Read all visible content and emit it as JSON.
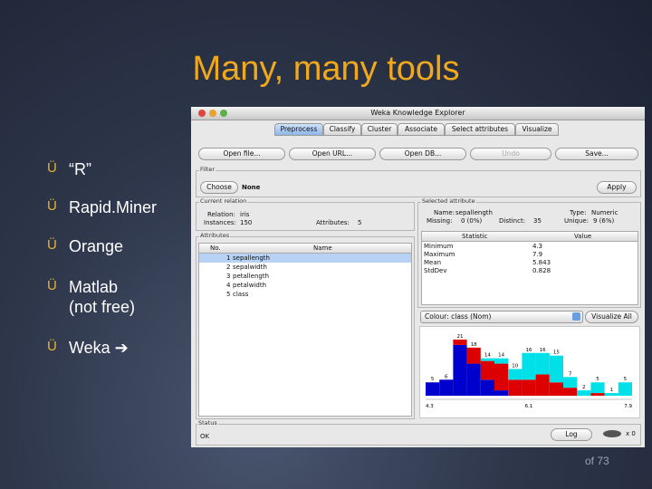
{
  "slide": {
    "title": "Many, many tools",
    "page_number": "of 73",
    "bullets": [
      {
        "mark": "Ü",
        "lines": [
          "“R”"
        ]
      },
      {
        "mark": "Ü",
        "lines": [
          "Rapid.Miner"
        ]
      },
      {
        "mark": "Ü",
        "lines": [
          "Orange"
        ]
      },
      {
        "mark": "Ü",
        "lines": [
          "Matlab",
          "(not free)"
        ]
      },
      {
        "mark": "Ü",
        "lines": [
          "Weka ➔"
        ]
      }
    ]
  },
  "weka": {
    "window_title": "Weka Knowledge Explorer",
    "tabs": [
      "Preprocess",
      "Classify",
      "Cluster",
      "Associate",
      "Select attributes",
      "Visualize"
    ],
    "active_tab": "Preprocess",
    "toolbar": {
      "open_file": "Open file...",
      "open_url": "Open URL...",
      "open_db": "Open DB...",
      "undo": "Undo",
      "save": "Save..."
    },
    "filter": {
      "label": "Filter",
      "choose": "Choose",
      "value": "None",
      "apply": "Apply"
    },
    "current_relation": {
      "label": "Current relation",
      "relation_label": "Relation:",
      "relation": "iris",
      "instances_label": "Instances:",
      "instances": "150",
      "attributes_label": "Attributes:",
      "attributes": "5"
    },
    "attributes": {
      "label": "Attributes",
      "columns": [
        "No.",
        "Name"
      ],
      "rows": [
        {
          "no": "1",
          "name": "sepallength"
        },
        {
          "no": "2",
          "name": "sepalwidth"
        },
        {
          "no": "3",
          "name": "petallength"
        },
        {
          "no": "4",
          "name": "petalwidth"
        },
        {
          "no": "5",
          "name": "class"
        }
      ],
      "selected_index": 0
    },
    "selected_attribute": {
      "label": "Selected attribute",
      "name_label": "Name:",
      "name": "sepallength",
      "type_label": "Type:",
      "type": "Numeric",
      "missing_label": "Missing:",
      "missing": "0 (0%)",
      "distinct_label": "Distinct:",
      "distinct": "35",
      "unique_label": "Unique:",
      "unique": "9 (6%)",
      "columns": [
        "Statistic",
        "Value"
      ],
      "stats": [
        {
          "statistic": "Minimum",
          "value": "4.3"
        },
        {
          "statistic": "Maximum",
          "value": "7.9"
        },
        {
          "statistic": "Mean",
          "value": "5.843"
        },
        {
          "statistic": "StdDev",
          "value": "0.828"
        }
      ]
    },
    "class_select": "Colour: class (Nom)",
    "visualize_all": "Visualize All",
    "histogram": {
      "colors": {
        "setosa": "#0000cc",
        "versicolor": "#dd0000",
        "virginica": "#00e0e8"
      },
      "bins": [
        {
          "total": 5,
          "setosa": 5,
          "versicolor": 0,
          "virginica": 0
        },
        {
          "total": 6,
          "setosa": 6,
          "versicolor": 0,
          "virginica": 0
        },
        {
          "total": 21,
          "setosa": 19,
          "versicolor": 2,
          "virginica": 0
        },
        {
          "total": 18,
          "setosa": 12,
          "versicolor": 6,
          "virginica": 0
        },
        {
          "total": 14,
          "setosa": 6,
          "versicolor": 7,
          "virginica": 1
        },
        {
          "total": 14,
          "setosa": 2,
          "versicolor": 10,
          "virginica": 2
        },
        {
          "total": 10,
          "setosa": 0,
          "versicolor": 6,
          "virginica": 4
        },
        {
          "total": 16,
          "setosa": 0,
          "versicolor": 6,
          "virginica": 10
        },
        {
          "total": 16,
          "setosa": 0,
          "versicolor": 8,
          "virginica": 8
        },
        {
          "total": 15,
          "setosa": 0,
          "versicolor": 5,
          "virginica": 10
        },
        {
          "total": 7,
          "setosa": 0,
          "versicolor": 3,
          "virginica": 4
        },
        {
          "total": 2,
          "setosa": 0,
          "versicolor": 0,
          "virginica": 2
        },
        {
          "total": 5,
          "setosa": 0,
          "versicolor": 1,
          "virginica": 4
        },
        {
          "total": 1,
          "setosa": 0,
          "versicolor": 0,
          "virginica": 1
        },
        {
          "total": 5,
          "setosa": 0,
          "versicolor": 0,
          "virginica": 5
        }
      ],
      "max": 21,
      "x_labels": [
        "4.3",
        "6.1",
        "7.9"
      ]
    },
    "status": {
      "label": "Status",
      "text": "OK",
      "log": "Log",
      "count": "x 0"
    }
  }
}
